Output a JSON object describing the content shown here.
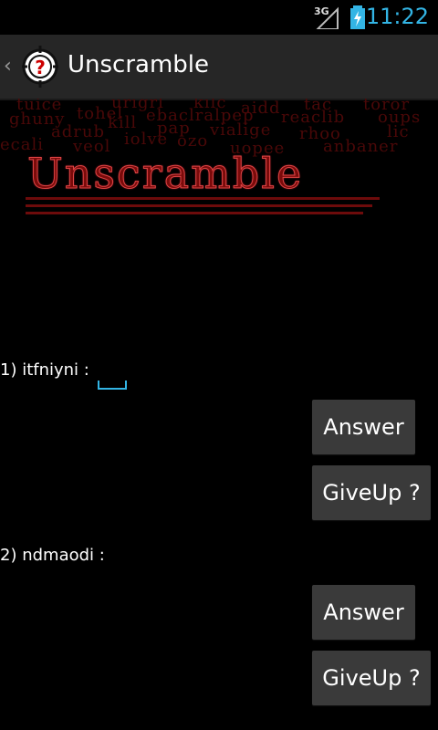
{
  "status_bar": {
    "network": "3G",
    "time": "11:22",
    "accent": "#33b5e5"
  },
  "action_bar": {
    "title": "Unscramble",
    "up_icon": "chevron-left-icon",
    "app_icon": "target-question-icon"
  },
  "banner": {
    "logo_text": "Unscramble",
    "scrambled_words": [
      "tuice",
      "urigrl",
      "kilc",
      "aidd",
      "tac",
      "toror",
      "ghuny",
      "tohel",
      "kill",
      "ebaclralpep",
      "reaclib",
      "oups",
      "adrub",
      "pap",
      "vialige",
      "rhoo",
      "lic",
      "ecali",
      "veol",
      "iolve",
      "ozo",
      "uopee",
      "anbaner"
    ]
  },
  "questions": [
    {
      "label": "1) itfniyni :",
      "answer_button": "Answer",
      "giveup_button": "GiveUp ?"
    },
    {
      "label": "2) ndmaodi :",
      "answer_button": "Answer",
      "giveup_button": "GiveUp ?"
    }
  ]
}
